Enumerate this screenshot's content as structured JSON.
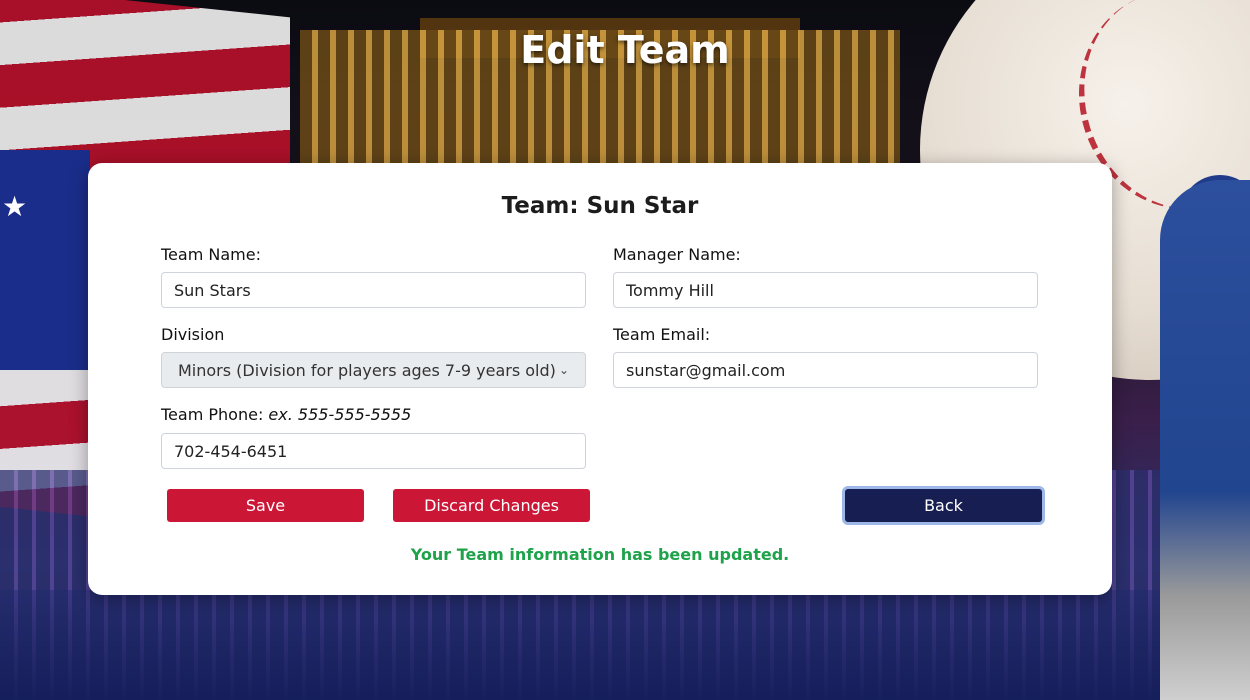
{
  "page": {
    "title": "Edit Team"
  },
  "card": {
    "title": "Team: Sun Star"
  },
  "form": {
    "team_name_label": "Team Name:",
    "team_name_value": "Sun Stars",
    "manager_name_label": "Manager Name:",
    "manager_name_value": "Tommy Hill",
    "division_label": "Division",
    "division_value": "Minors (Division for players ages 7-9 years old)",
    "team_email_label": "Team Email:",
    "team_email_value": "sunstar@gmail.com",
    "team_phone_label": "Team Phone: ",
    "team_phone_hint": "ex. 555-555-5555",
    "team_phone_value": "702-454-6451"
  },
  "buttons": {
    "save": "Save",
    "discard": "Discard Changes",
    "back": "Back"
  },
  "status": {
    "message": "Your Team information has been updated."
  },
  "icons": {
    "select_chevron": "chevron-down-icon"
  },
  "colors": {
    "button_red": "#cc1636",
    "button_navy": "#171f52",
    "status_green": "#1fa34a"
  }
}
